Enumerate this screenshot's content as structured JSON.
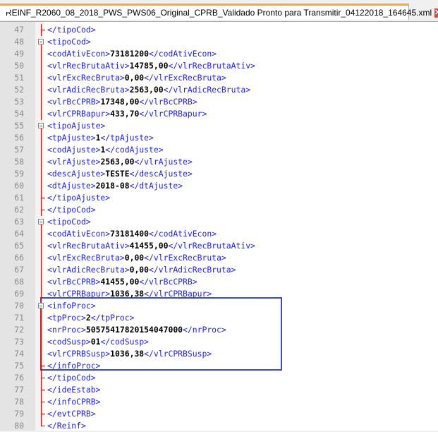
{
  "tab": {
    "title": "REINF_R2060_08_2018_PWS_PWS06_Original_CPRB_Validado Pronto para Transmitir_04122018_164645.xml",
    "close": "✕"
  },
  "lines": [
    {
      "n": "47",
      "fold": "tee",
      "a": "</tipoCod>",
      "v": "",
      "b": ""
    },
    {
      "n": "48",
      "fold": "box",
      "a": "<tipoCod>",
      "v": "",
      "b": ""
    },
    {
      "n": "49",
      "fold": "",
      "a": "<codAtivEcon>",
      "v": "73181200",
      "b": "</codAtivEcon>"
    },
    {
      "n": "50",
      "fold": "",
      "a": "<vlrRecBrutaAtiv>",
      "v": "14785,00",
      "b": "</vlrRecBrutaAtiv>"
    },
    {
      "n": "51",
      "fold": "",
      "a": "<vlrExcRecBruta>",
      "v": "0,00",
      "b": "</vlrExcRecBruta>"
    },
    {
      "n": "52",
      "fold": "",
      "a": "<vlrAdicRecBruta>",
      "v": "2563,00",
      "b": "</vlrAdicRecBruta>"
    },
    {
      "n": "53",
      "fold": "",
      "a": "<vlrBcCPRB>",
      "v": "17348,00",
      "b": "</vlrBcCPRB>"
    },
    {
      "n": "54",
      "fold": "",
      "a": "<vlrCPRBapur>",
      "v": "433,70",
      "b": "</vlrCPRBapur>"
    },
    {
      "n": "55",
      "fold": "box",
      "a": "<tipoAjuste>",
      "v": "",
      "b": ""
    },
    {
      "n": "56",
      "fold": "",
      "a": "<tpAjuste>",
      "v": "1",
      "b": "</tpAjuste>"
    },
    {
      "n": "57",
      "fold": "",
      "a": "<codAjuste>",
      "v": "1",
      "b": "</codAjuste>"
    },
    {
      "n": "58",
      "fold": "",
      "a": "<vlrAjuste>",
      "v": "2563,00",
      "b": "</vlrAjuste>"
    },
    {
      "n": "59",
      "fold": "",
      "a": "<descAjuste>",
      "v": "TESTE",
      "b": "</descAjuste>"
    },
    {
      "n": "60",
      "fold": "",
      "a": "<dtAjuste>",
      "v": "2018-08",
      "b": "</dtAjuste>"
    },
    {
      "n": "61",
      "fold": "tee",
      "a": "</tipoAjuste>",
      "v": "",
      "b": ""
    },
    {
      "n": "62",
      "fold": "tee",
      "a": "</tipoCod>",
      "v": "",
      "b": ""
    },
    {
      "n": "63",
      "fold": "box",
      "a": "<tipoCod>",
      "v": "",
      "b": ""
    },
    {
      "n": "64",
      "fold": "",
      "a": "<codAtivEcon>",
      "v": "73181400",
      "b": "</codAtivEcon>"
    },
    {
      "n": "65",
      "fold": "",
      "a": "<vlrRecBrutaAtiv>",
      "v": "41455,00",
      "b": "</vlrRecBrutaAtiv>"
    },
    {
      "n": "66",
      "fold": "",
      "a": "<vlrExcRecBruta>",
      "v": "0,00",
      "b": "</vlrExcRecBruta>"
    },
    {
      "n": "67",
      "fold": "",
      "a": "<vlrAdicRecBruta>",
      "v": "0,00",
      "b": "</vlrAdicRecBruta>"
    },
    {
      "n": "68",
      "fold": "",
      "a": "<vlrBcCPRB>",
      "v": "41455,00",
      "b": "</vlrBcCPRB>"
    },
    {
      "n": "69",
      "fold": "",
      "a": "<vlrCPRBapur>",
      "v": "1036,38",
      "b": "</vlrCPRBapur>"
    },
    {
      "n": "70",
      "fold": "box",
      "a": "<infoProc>",
      "v": "",
      "b": ""
    },
    {
      "n": "71",
      "fold": "",
      "a": "<tpProc>",
      "v": "2",
      "b": "</tpProc>"
    },
    {
      "n": "72",
      "fold": "",
      "a": "<nrProc>",
      "v": "5057541782015404700​0",
      "b": "</nrProc>"
    },
    {
      "n": "73",
      "fold": "",
      "a": "<codSusp>",
      "v": "01",
      "b": "</codSusp>"
    },
    {
      "n": "74",
      "fold": "",
      "a": "<vlrCPRBSusp>",
      "v": "1036,38",
      "b": "</vlrCPRBSusp>"
    },
    {
      "n": "75",
      "fold": "tee",
      "a": "</infoProc>",
      "v": "",
      "b": ""
    },
    {
      "n": "76",
      "fold": "tee",
      "a": "</tipoCod>",
      "v": "",
      "b": ""
    },
    {
      "n": "77",
      "fold": "tee",
      "a": "</ideEstab>",
      "v": "",
      "b": ""
    },
    {
      "n": "78",
      "fold": "tee",
      "a": "</infoCPRB>",
      "v": "",
      "b": ""
    },
    {
      "n": "79",
      "fold": "tee",
      "a": "</evtCPRB>",
      "v": "",
      "b": ""
    },
    {
      "n": "80",
      "fold": "end",
      "a": "</Reinf>",
      "v": "",
      "b": ""
    }
  ]
}
